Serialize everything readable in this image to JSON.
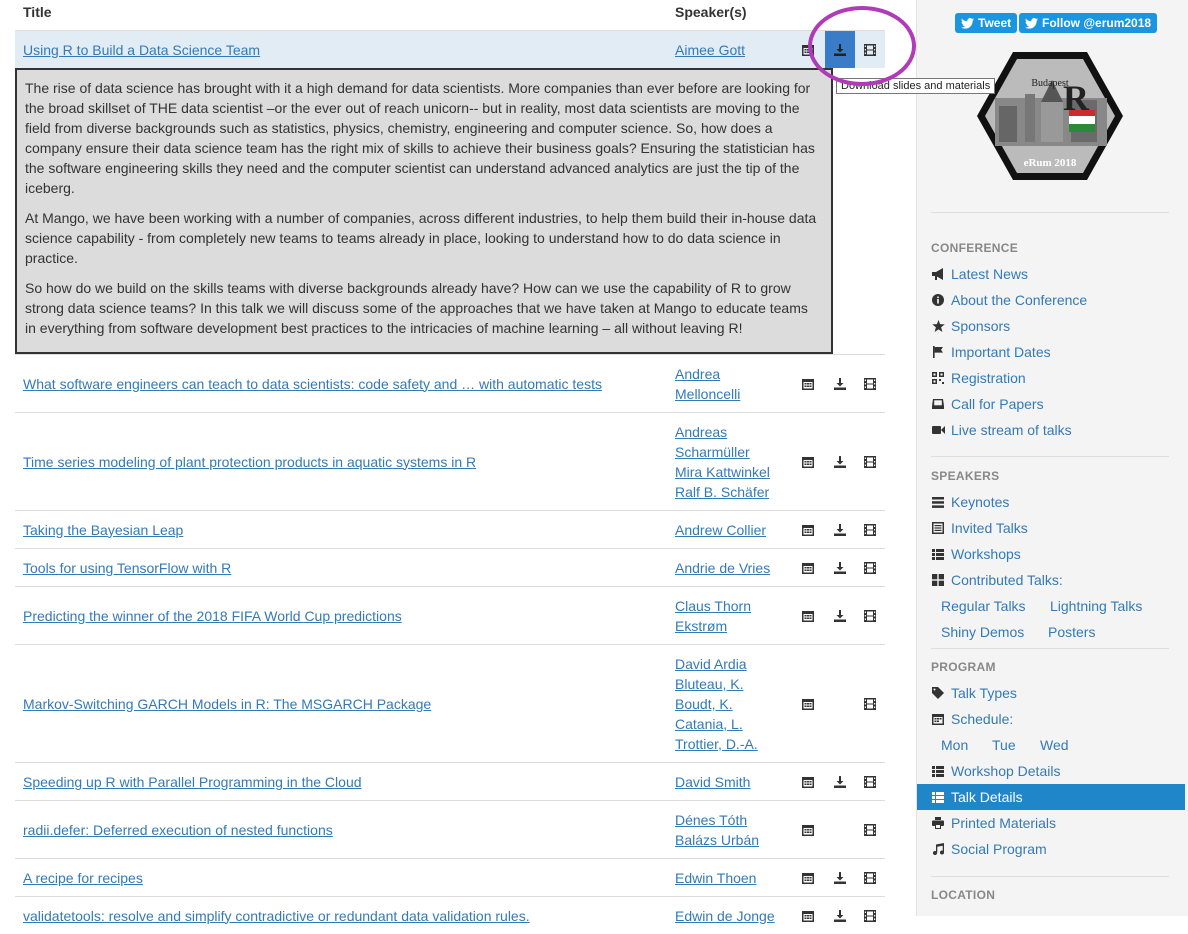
{
  "table": {
    "headers": {
      "title": "Title",
      "speakers": "Speaker(s)"
    },
    "tooltip": "Download slides and materials",
    "selected": {
      "title": "Using R to Build a Data Science Team",
      "speakers": [
        "Aimee Gott"
      ],
      "abstract": [
        "The rise of data science has brought with it a high demand for data scientists. More companies than ever before are looking for the broad skillset of THE data scientist –or the ever out of reach unicorn-- but in reality, most data scientists are moving to the field from diverse backgrounds such as statistics, physics, chemistry, engineering and computer science. So, how does a company ensure their data science team has the right mix of skills to achieve their business goals? Ensuring the statistician has the software engineering skills they need and the computer scientist can understand advanced analytics are just the tip of the iceberg.",
        "At Mango, we have been working with a number of companies, across different industries, to help them build their in-house data science capability - from completely new teams to teams already in place, looking to understand how to do data science in practice.",
        "So how do we build on the skills teams with diverse backgrounds already have? How can we use the capability of R to grow strong data science teams? In this talk we will discuss some of the approaches that we have taken at Mango to educate teams in everything from software development best practices to the intricacies of machine learning – all without leaving R!"
      ]
    },
    "rows": [
      {
        "title": "What software engineers can teach to data scientists: code safety and … with automatic tests",
        "speakers": [
          "Andrea",
          "Melloncelli"
        ],
        "download": true
      },
      {
        "title": "Time series modeling of plant protection products in aquatic systems in R",
        "speakers": [
          "Andreas",
          "Scharmüller",
          "Mira Kattwinkel",
          "Ralf B. Schäfer"
        ],
        "download": true
      },
      {
        "title": "Taking the Bayesian Leap",
        "speakers": [
          "Andrew Collier"
        ],
        "download": true
      },
      {
        "title": "Tools for using TensorFlow with R",
        "speakers": [
          "Andrie de Vries"
        ],
        "download": true
      },
      {
        "title": "Predicting the winner of the 2018 FIFA World Cup predictions",
        "speakers": [
          "Claus Thorn",
          "Ekstrøm"
        ],
        "download": true
      },
      {
        "title": "Markov-Switching GARCH Models in R: The MSGARCH Package",
        "speakers": [
          "David Ardia",
          "Bluteau, K.",
          "Boudt, K.",
          "Catania, L.",
          "Trottier, D.-A."
        ],
        "download": false
      },
      {
        "title": "Speeding up R with Parallel Programming in the Cloud",
        "speakers": [
          "David Smith"
        ],
        "download": true
      },
      {
        "title": "radii.defer: Deferred execution of nested functions",
        "speakers": [
          "Dénes Tóth",
          "Balázs Urbán"
        ],
        "download": false
      },
      {
        "title": "A recipe for recipes",
        "speakers": [
          "Edwin Thoen"
        ],
        "download": true
      },
      {
        "title": "validatetools: resolve and simplify contradictive or redundant data validation rules.",
        "speakers": [
          "Edwin de Jonge"
        ],
        "download": true
      }
    ]
  },
  "sidebar": {
    "tweet": "Tweet",
    "follow": "Follow @erum2018",
    "logo": {
      "top": "Budapest",
      "bottom": "eRum 2018"
    },
    "conference": {
      "header": "CONFERENCE",
      "items": [
        "Latest News",
        "About the Conference",
        "Sponsors",
        "Important Dates",
        "Registration",
        "Call for Papers",
        "Live stream of talks"
      ]
    },
    "speakers": {
      "header": "SPEAKERS",
      "items": [
        "Keynotes",
        "Invited Talks",
        "Workshops",
        "Contributed Talks:"
      ],
      "sub": [
        "Regular Talks",
        "Lightning Talks",
        "Shiny Demos",
        "Posters"
      ]
    },
    "program": {
      "header": "PROGRAM",
      "talk_types": "Talk Types",
      "schedule": "Schedule:",
      "days": [
        "Mon",
        "Tue",
        "Wed"
      ],
      "items": [
        "Workshop Details",
        "Talk Details",
        "Printed Materials",
        "Social Program"
      ]
    },
    "location": {
      "header": "LOCATION"
    }
  }
}
